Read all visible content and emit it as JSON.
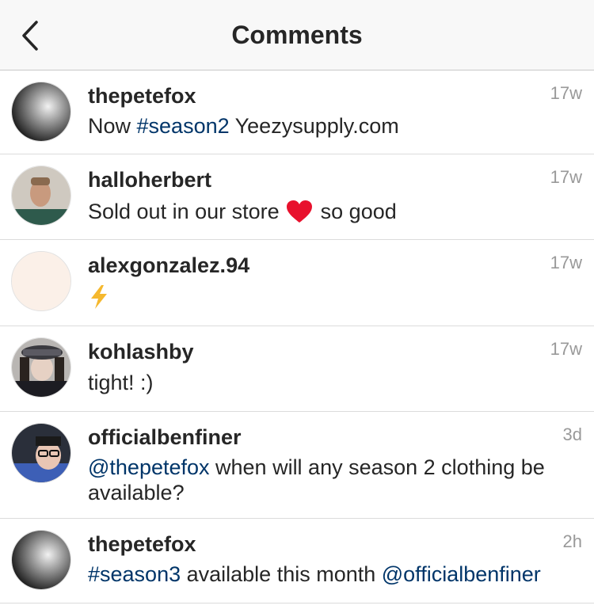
{
  "header": {
    "title": "Comments",
    "back_icon": "chevron-left-icon"
  },
  "comments": [
    {
      "username": "thepetefox",
      "time": "17w",
      "parts": [
        "Now ",
        "#season2",
        " Yeezysupply.com"
      ]
    },
    {
      "username": "halloherbert",
      "time": "17w",
      "parts": [
        "Sold out in our store",
        "so good"
      ],
      "emoji": "heart-icon"
    },
    {
      "username": "alexgonzalez.94",
      "time": "17w",
      "parts": [],
      "emoji": "lightning-icon"
    },
    {
      "username": "kohlashby",
      "time": "17w",
      "parts": [
        "tight! :)"
      ]
    },
    {
      "username": "officialbenfiner",
      "time": "3d",
      "parts": [
        "@thepetefox",
        " when will any season 2 clothing be available?"
      ]
    },
    {
      "username": "thepetefox",
      "time": "2h",
      "parts": [
        "#season3",
        " available this month ",
        "@officialbenfiner"
      ]
    }
  ],
  "colors": {
    "link": "#003569",
    "text": "#262626",
    "muted": "#999999",
    "header_bg": "#f8f8f8"
  }
}
